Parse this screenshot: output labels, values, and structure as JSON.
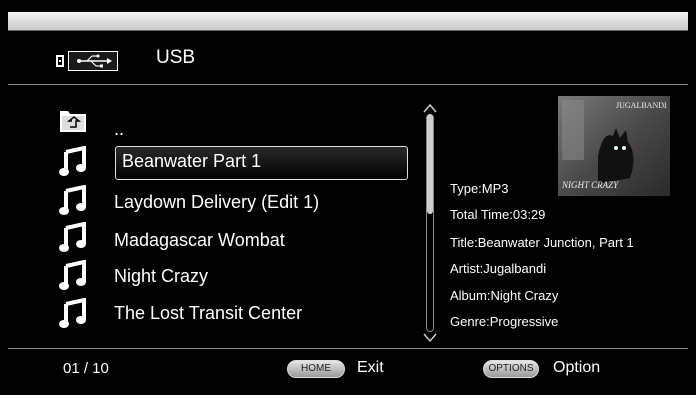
{
  "header": {
    "title": "USB",
    "icon": "usb-icon"
  },
  "list": {
    "items": [
      {
        "label": "..",
        "icon": "folder-up-icon"
      },
      {
        "label": "Beanwater Part 1",
        "icon": "music-note-icon",
        "selected": true
      },
      {
        "label": "Laydown Delivery (Edit 1)",
        "icon": "music-note-icon"
      },
      {
        "label": "Madagascar Wombat",
        "icon": "music-note-icon"
      },
      {
        "label": "Night Crazy",
        "icon": "music-note-icon"
      },
      {
        "label": "The Lost Transit Center",
        "icon": "music-note-icon"
      }
    ]
  },
  "scrollbar": {
    "position": 0.0,
    "visible_fraction": 0.46
  },
  "album": {
    "art_title": "NIGHT CRAZY",
    "art_artist": "JUGALBANDI"
  },
  "info": {
    "type": "Type:MP3",
    "total_time": "Total Time:03:29",
    "title": "Title:Beanwater Junction, Part 1",
    "artist": "Artist:Jugalbandi",
    "album": "Album:Night Crazy",
    "genre": "Genre:Progressive"
  },
  "footer": {
    "page": "01 / 10",
    "home_key": "HOME",
    "home_label": "Exit",
    "options_key": "OPTIONS",
    "options_label": "Option"
  },
  "colors": {
    "background": "#000000",
    "text": "#ffffff",
    "bezel_top": "#e0e0e0",
    "pill": "#c8c8c8"
  }
}
